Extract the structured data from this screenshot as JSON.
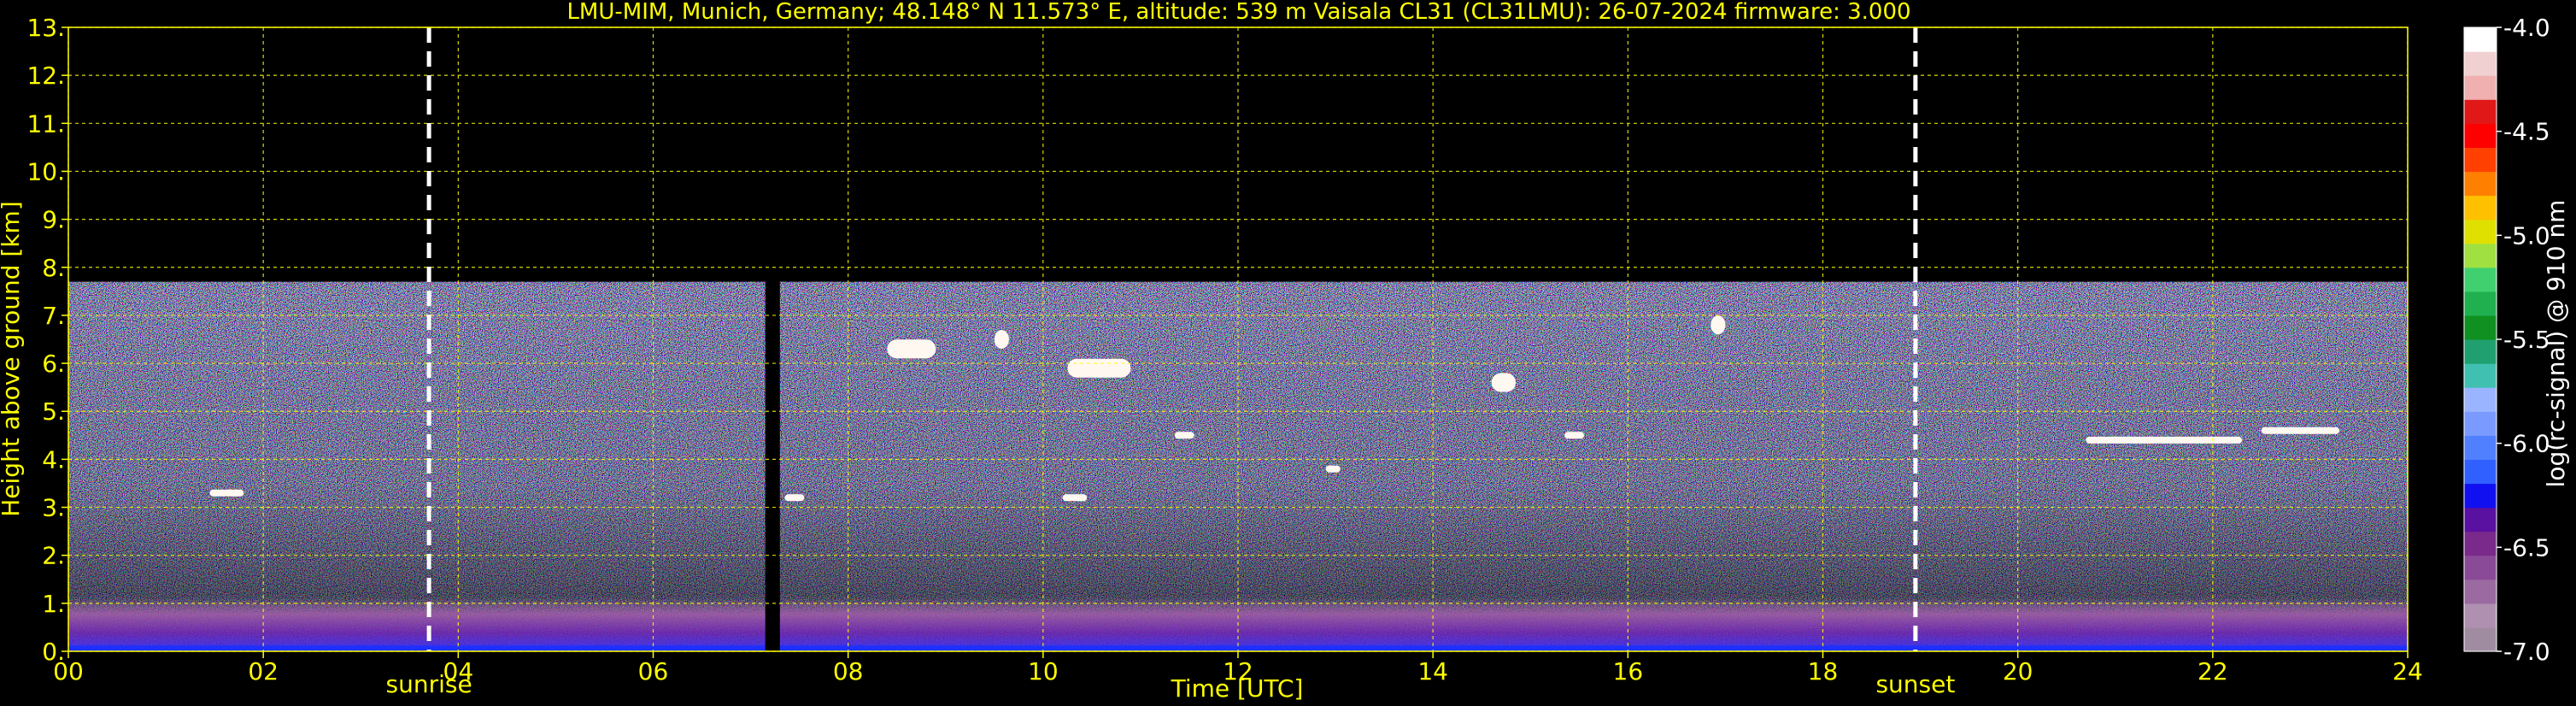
{
  "title": "LMU-MIM, Munich, Germany; 48.148° N 11.573° E, altitude: 539 m    Vaisala CL31 (CL31LMU): 26-07-2024    firmware: 3.000",
  "chart_data": {
    "type": "heatmap",
    "xlabel": "Time [UTC]",
    "ylabel": "Height above ground [km]",
    "xlim": [
      0,
      24
    ],
    "ylim": [
      0,
      13
    ],
    "x_ticks": [
      "00",
      "02",
      "04",
      "06",
      "08",
      "10",
      "12",
      "14",
      "16",
      "18",
      "20",
      "22",
      "24"
    ],
    "x_tick_values": [
      0,
      2,
      4,
      6,
      8,
      10,
      12,
      14,
      16,
      18,
      20,
      22,
      24
    ],
    "y_ticks": [
      "0.",
      "1.",
      "2.",
      "3.",
      "4.",
      "5.",
      "6.",
      "7.",
      "8.",
      "9.",
      "10.",
      "11.",
      "12.",
      "13."
    ],
    "y_tick_values": [
      0,
      1,
      2,
      3,
      4,
      5,
      6,
      7,
      8,
      9,
      10,
      11,
      12,
      13
    ],
    "grid": true,
    "grid_color": "#ffff00",
    "background_color": "#000000",
    "data_top_km": 7.7,
    "data_gap_hours": [
      7.15,
      7.3
    ],
    "events": [
      {
        "label": "sunrise",
        "time": 3.7
      },
      {
        "label": "sunset",
        "time": 18.95
      }
    ],
    "colorbar": {
      "label": "log(rc-signal) @ 910 nm",
      "range": [
        -7.0,
        -4.0
      ],
      "ticks": [
        "-4.0",
        "-4.5",
        "-5.0",
        "-5.5",
        "-6.0",
        "-6.5",
        "-7.0"
      ],
      "tick_values": [
        -4.0,
        -4.5,
        -5.0,
        -5.5,
        -6.0,
        -6.5,
        -7.0
      ],
      "colors_low_to_high": [
        "#a08ca0",
        "#b090b0",
        "#9a6aa0",
        "#8a4a98",
        "#7a2a8a",
        "#5a10a0",
        "#1010f0",
        "#3060ff",
        "#5080ff",
        "#7a9aff",
        "#9ab4ff",
        "#40c0b0",
        "#20a070",
        "#109020",
        "#20b050",
        "#40d070",
        "#a0e040",
        "#e0e000",
        "#ffc000",
        "#ff8000",
        "#ff4000",
        "#ff0000",
        "#e01818",
        "#f0b0b0",
        "#f0d0d0",
        "#ffffff"
      ]
    },
    "cloud_features": [
      {
        "time_start": 1.45,
        "time_end": 1.8,
        "height_km": 3.3
      },
      {
        "time_start": 7.35,
        "time_end": 7.55,
        "height_km": 3.2
      },
      {
        "time_start": 8.4,
        "time_end": 8.9,
        "height_km": 6.3
      },
      {
        "time_start": 9.5,
        "time_end": 9.65,
        "height_km": 6.5
      },
      {
        "time_start": 10.25,
        "time_end": 10.9,
        "height_km": 5.9
      },
      {
        "time_start": 10.2,
        "time_end": 10.45,
        "height_km": 3.2
      },
      {
        "time_start": 11.35,
        "time_end": 11.55,
        "height_km": 4.5
      },
      {
        "time_start": 12.9,
        "time_end": 13.05,
        "height_km": 3.8
      },
      {
        "time_start": 14.6,
        "time_end": 14.85,
        "height_km": 5.6
      },
      {
        "time_start": 15.35,
        "time_end": 15.55,
        "height_km": 4.5
      },
      {
        "time_start": 16.85,
        "time_end": 17.0,
        "height_km": 6.8
      },
      {
        "time_start": 20.7,
        "time_end": 22.3,
        "height_km": 4.4
      },
      {
        "time_start": 22.5,
        "time_end": 23.3,
        "height_km": 4.6
      }
    ]
  }
}
